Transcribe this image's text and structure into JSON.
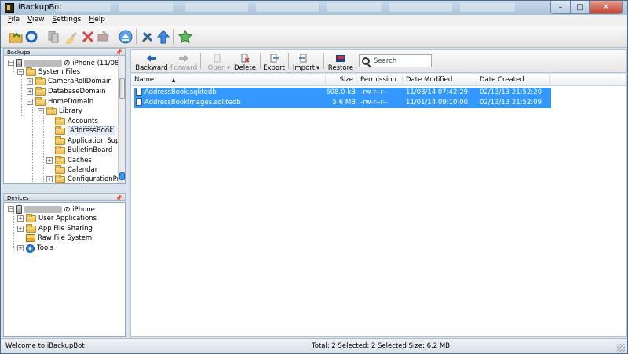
{
  "window": {
    "title": "iBackupBot",
    "controls": {
      "minimize": "–",
      "maximize": "□",
      "close": "✕"
    }
  },
  "menu": [
    {
      "label": "File",
      "key": "F",
      "rest": "ile"
    },
    {
      "label": "View",
      "key": "V",
      "rest": "iew"
    },
    {
      "label": "Settings",
      "key": "S",
      "rest": "ettings"
    },
    {
      "label": "Help",
      "key": "H",
      "rest": "elp"
    }
  ],
  "backups_pane": {
    "title": "Backups",
    "pin": "📌",
    "device_label": "の iPhone (11/08/14",
    "nodes": [
      {
        "label": "System Files"
      },
      {
        "label": "CameraRollDomain"
      },
      {
        "label": "DatabaseDomain"
      },
      {
        "label": "HomeDomain"
      },
      {
        "label": "Library"
      },
      {
        "label": "Accounts"
      },
      {
        "label": "AddressBook"
      },
      {
        "label": "Application Suppo"
      },
      {
        "label": "BulletinBoard"
      },
      {
        "label": "Caches"
      },
      {
        "label": "Calendar"
      },
      {
        "label": "ConfigurationProfi"
      }
    ]
  },
  "devices_pane": {
    "title": "Devices",
    "pin": "📌",
    "device_label": "の iPhone",
    "nodes": [
      {
        "label": "User Applications"
      },
      {
        "label": "App File Sharing"
      },
      {
        "label": "Raw File System"
      },
      {
        "label": "Tools"
      }
    ]
  },
  "file_toolbar": {
    "backward": "Backward",
    "forward": "Forward",
    "open": "Open",
    "delete": "Delete",
    "export": "Export",
    "import": "Import",
    "restore": "Restore",
    "search_placeholder": "Search"
  },
  "file_list": {
    "columns": {
      "name": "Name",
      "size": "Size",
      "permission": "Permission",
      "modified": "Date Modified",
      "created": "Date Created"
    },
    "rows": [
      {
        "name": "AddressBook.sqlitedb",
        "size": "608.0 kB",
        "permission": "-rw-r--r--",
        "modified": "11/08/14 07:42:29",
        "created": "02/13/13 21:52:20"
      },
      {
        "name": "AddressBookImages.sqlitedb",
        "size": "5.6 MB",
        "permission": "-rw-r--r--",
        "modified": "11/01/14 09:10:00",
        "created": "02/13/13 21:52:09"
      }
    ]
  },
  "status": {
    "left": "Welcome to iBackupBot",
    "summary": "Total: 2 Selected: 2 Selected Size: 6.2 MB"
  }
}
